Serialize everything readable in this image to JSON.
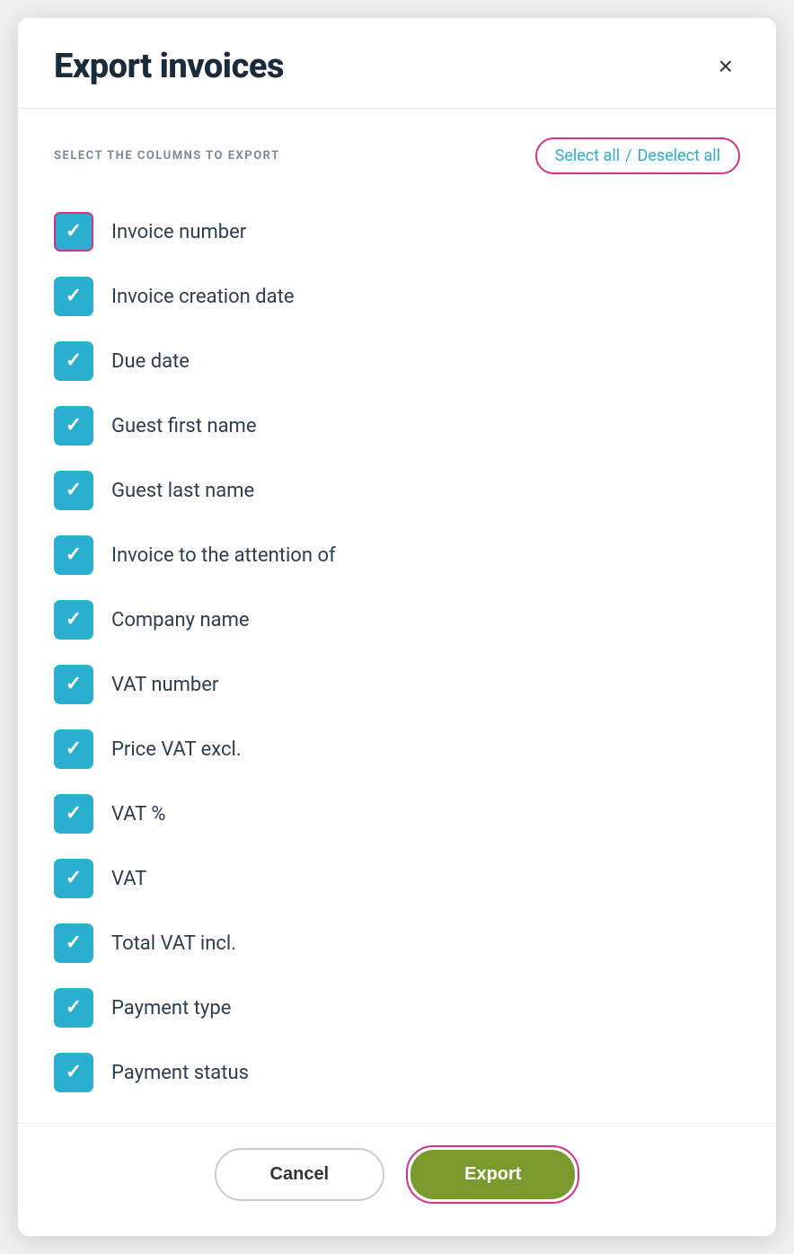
{
  "header": {
    "title": "Export invoices",
    "close_label": "×"
  },
  "columns_section": {
    "label": "SELECT THE COLUMNS TO EXPORT",
    "select_all": "Select all",
    "separator": "/",
    "deselect_all": "Deselect all"
  },
  "checkboxes": [
    {
      "id": "invoice-number",
      "label": "Invoice number",
      "checked": true,
      "highlighted": true
    },
    {
      "id": "invoice-creation-date",
      "label": "Invoice creation date",
      "checked": true,
      "highlighted": false
    },
    {
      "id": "due-date",
      "label": "Due date",
      "checked": true,
      "highlighted": false
    },
    {
      "id": "guest-first-name",
      "label": "Guest first name",
      "checked": true,
      "highlighted": false
    },
    {
      "id": "guest-last-name",
      "label": "Guest last name",
      "checked": true,
      "highlighted": false
    },
    {
      "id": "invoice-attention",
      "label": "Invoice to the attention of",
      "checked": true,
      "highlighted": false
    },
    {
      "id": "company-name",
      "label": "Company name",
      "checked": true,
      "highlighted": false
    },
    {
      "id": "vat-number",
      "label": "VAT number",
      "checked": true,
      "highlighted": false
    },
    {
      "id": "price-vat-excl",
      "label": "Price VAT excl.",
      "checked": true,
      "highlighted": false
    },
    {
      "id": "vat-percent",
      "label": "VAT %",
      "checked": true,
      "highlighted": false
    },
    {
      "id": "vat",
      "label": "VAT",
      "checked": true,
      "highlighted": false
    },
    {
      "id": "total-vat-incl",
      "label": "Total VAT incl.",
      "checked": true,
      "highlighted": false
    },
    {
      "id": "payment-type",
      "label": "Payment type",
      "checked": true,
      "highlighted": false
    },
    {
      "id": "payment-status",
      "label": "Payment status",
      "checked": true,
      "highlighted": false
    }
  ],
  "footer": {
    "cancel_label": "Cancel",
    "export_label": "Export"
  },
  "colors": {
    "accent": "#d63384",
    "checkbox_blue": "#2bafd1",
    "export_green": "#7a9a2e"
  }
}
